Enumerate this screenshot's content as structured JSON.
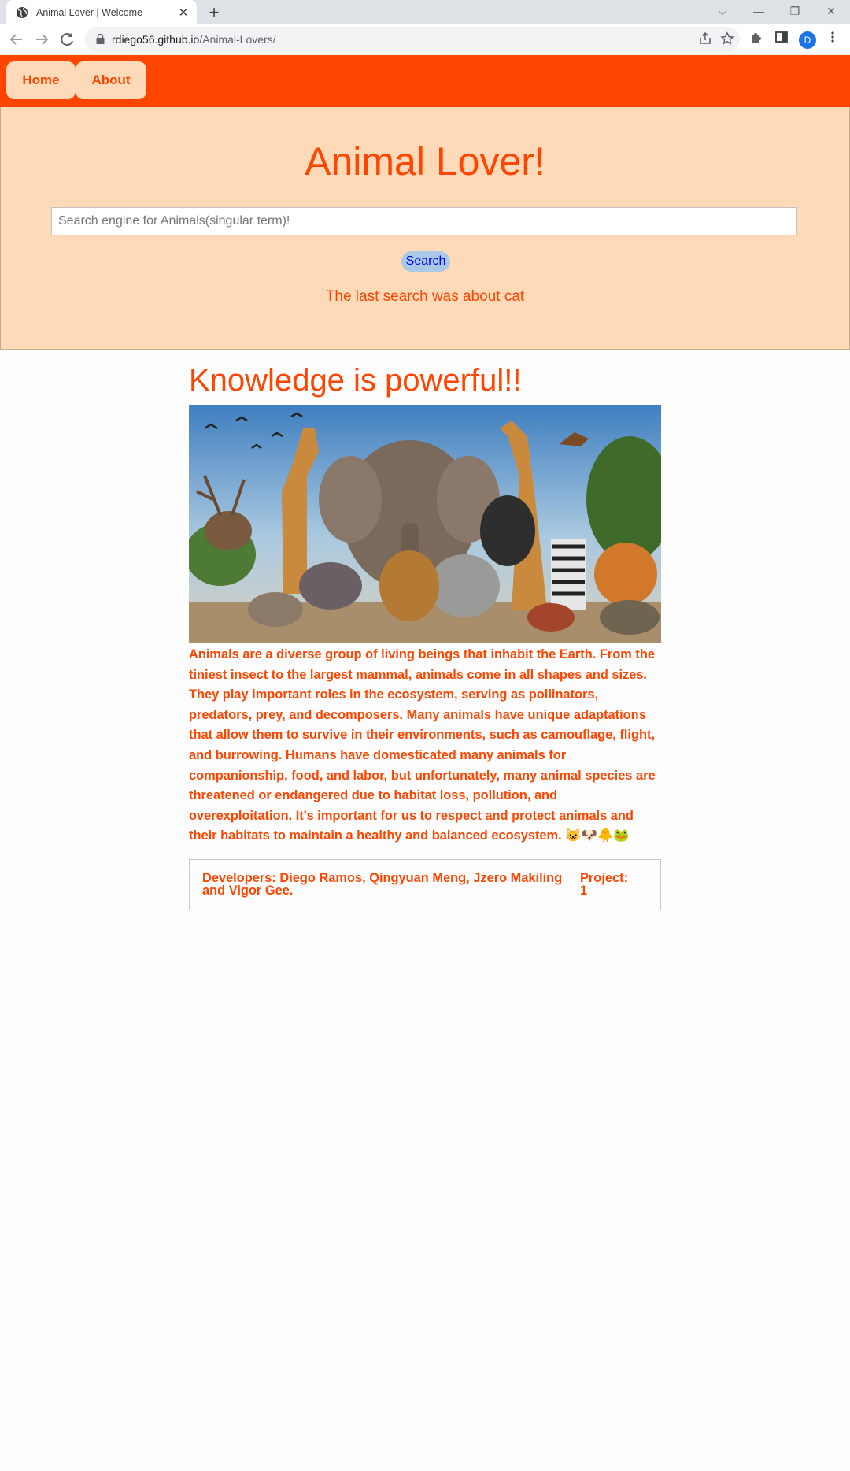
{
  "browser": {
    "tab_title": "Animal Lover | Welcome",
    "tab_close": "✕",
    "new_tab": "+",
    "url_host": "rdiego56.github.io",
    "url_path": "/Animal-Lovers/",
    "profile_initial": "D",
    "window_controls": [
      "⌵",
      "—",
      "❐",
      "✕"
    ]
  },
  "nav": {
    "items": [
      {
        "label": "Home"
      },
      {
        "label": "About"
      }
    ]
  },
  "hero": {
    "title": "Animal Lover!",
    "search_placeholder": "Search engine for Animals(singular term)!",
    "search_button": "Search",
    "last_search": "The last search was about cat"
  },
  "main": {
    "heading": "Knowledge is powerful!!",
    "intro": "Animals are a diverse group of living beings that inhabit the Earth. From the tiniest insect to the largest mammal, animals come in all shapes and sizes. They play important roles in the ecosystem, serving as pollinators, predators, prey, and decomposers. Many animals have unique adaptations that allow them to survive in their environments, such as camouflage, flight, and burrowing. Humans have domesticated many animals for companionship, food, and labor, but unfortunately, many animal species are threatened or endangered due to habitat loss, pollution, and overexploitation. It's important for us to respect and protect animals and their habitats to maintain a healthy and balanced ecosystem. 😺🐶🐥🐸"
  },
  "credits": {
    "developers": "Developers: Diego Ramos, Qingyuan Meng, Jzero Makiling and Vigor Gee.",
    "project": "Project: 1"
  },
  "colors": {
    "accent": "#ff4500",
    "hero_bg": "#ffdab9",
    "button_bg": "#a9c9e6"
  }
}
